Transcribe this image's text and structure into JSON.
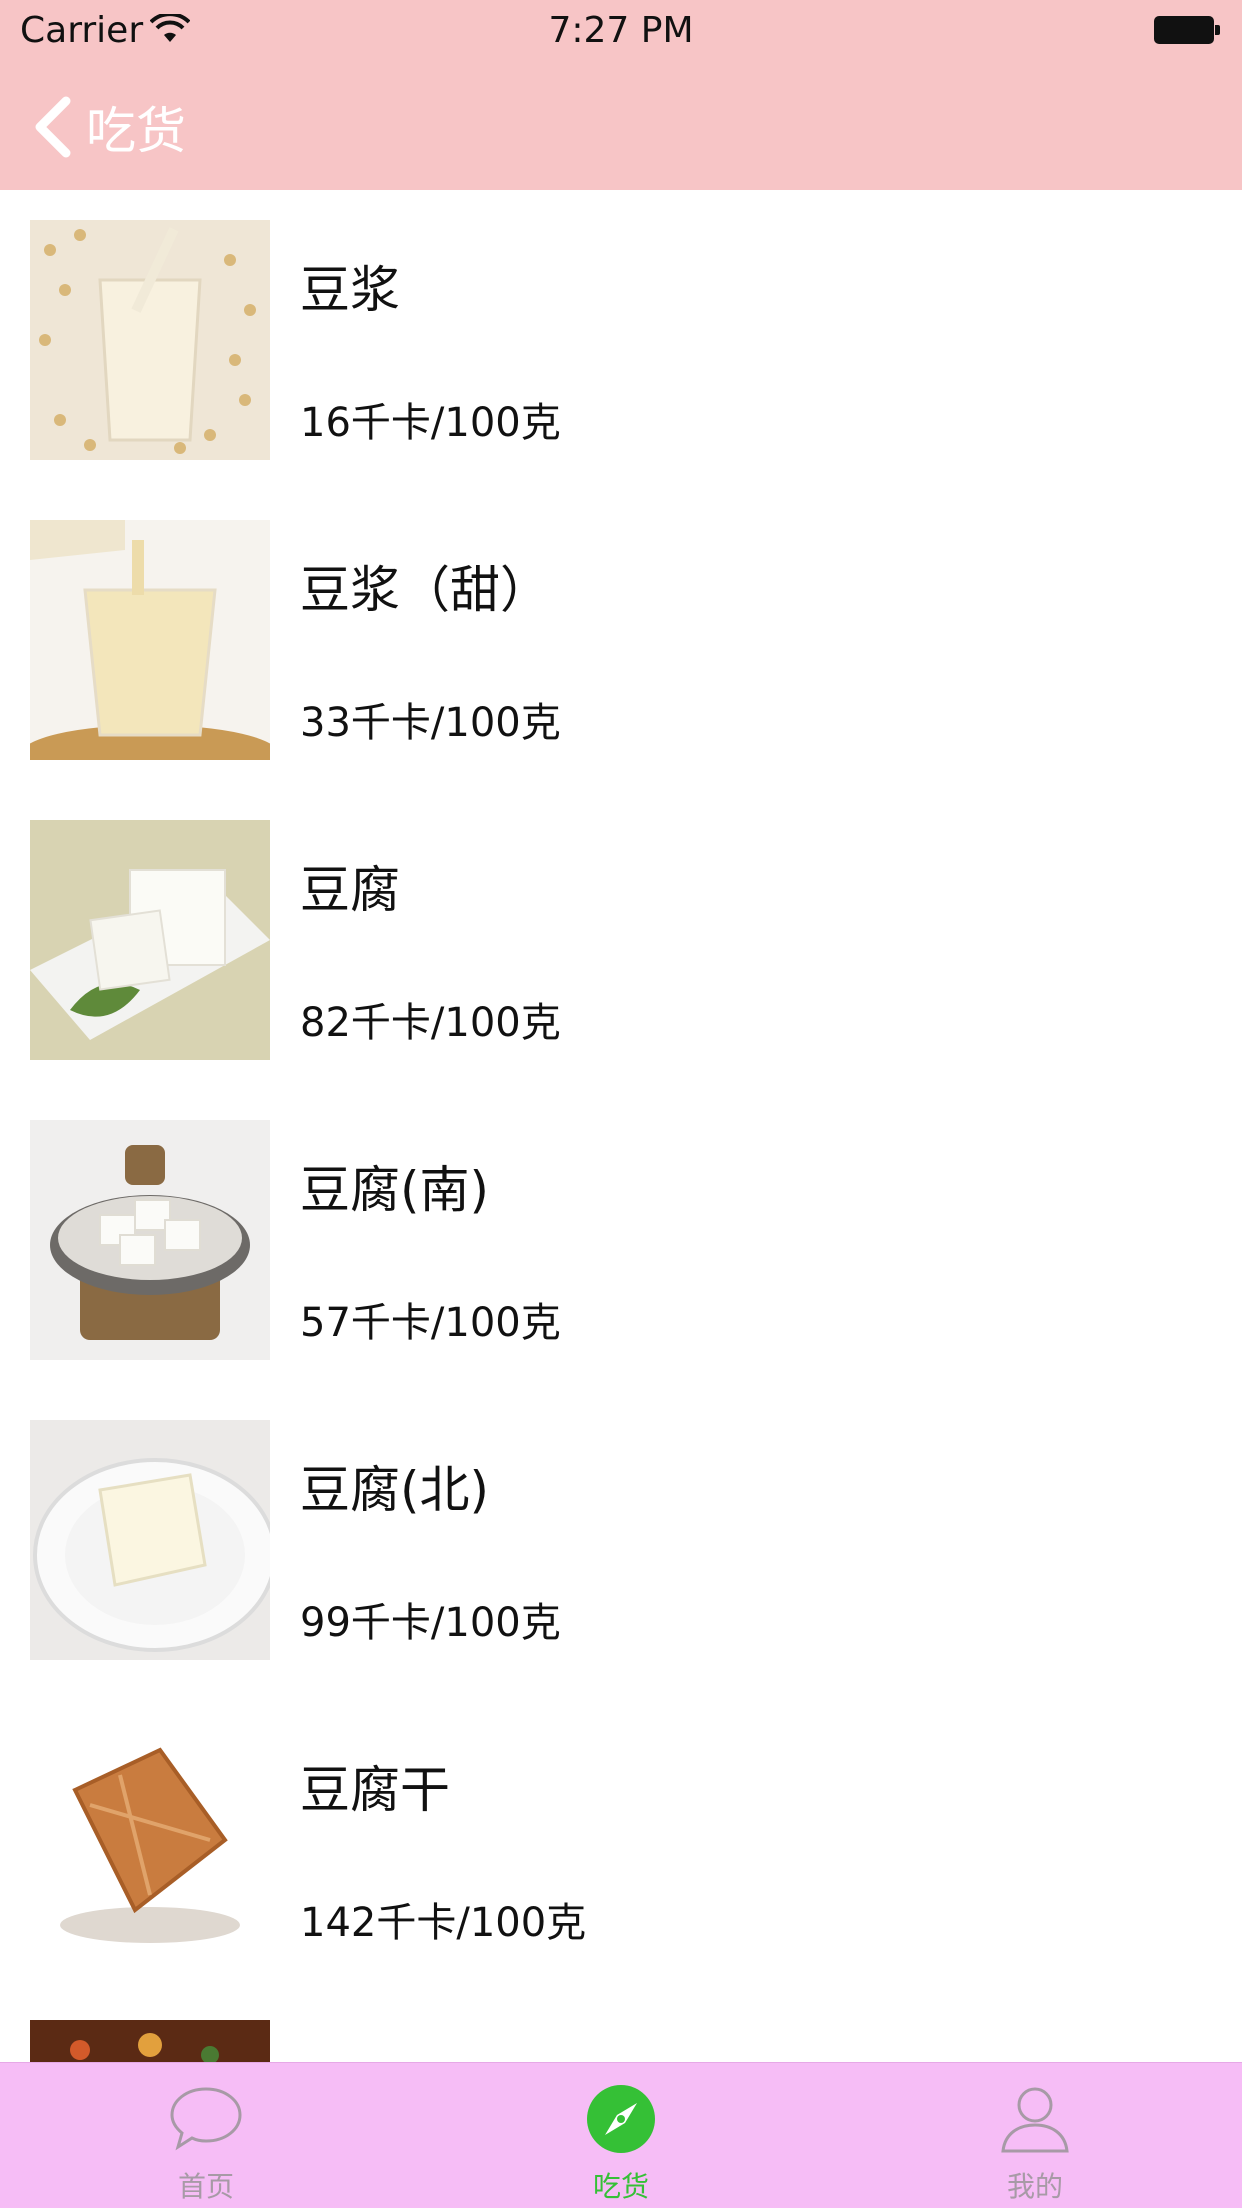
{
  "status_bar": {
    "carrier": "Carrier",
    "time": "7:27 PM"
  },
  "nav": {
    "back_label": "吃货"
  },
  "foods": [
    {
      "name": "豆浆",
      "calories": "16千卡/100克",
      "image": "soy-milk-glass-with-beans"
    },
    {
      "name": "豆浆（甜）",
      "calories": "33千卡/100克",
      "image": "soy-milk-pouring"
    },
    {
      "name": "豆腐",
      "calories": "82千卡/100克",
      "image": "tofu-on-plate"
    },
    {
      "name": "豆腐(南)",
      "calories": "57千卡/100克",
      "image": "tofu-in-bowl"
    },
    {
      "name": "豆腐(北)",
      "calories": "99千卡/100克",
      "image": "tofu-block-on-plate"
    },
    {
      "name": "豆腐干",
      "calories": "142千卡/100克",
      "image": "dried-tofu"
    },
    {
      "name": "",
      "calories": "",
      "image": "stew-partial"
    }
  ],
  "tabbar": {
    "items": [
      {
        "label": "首页",
        "icon": "chat-bubble-icon",
        "active": false
      },
      {
        "label": "吃货",
        "icon": "compass-icon",
        "active": true
      },
      {
        "label": "我的",
        "icon": "person-icon",
        "active": false
      }
    ],
    "active_color": "#35c036",
    "inactive_color": "#a79aa6"
  },
  "colors": {
    "header_bg": "#f7c5c6",
    "tabbar_bg": "#f6bdf6"
  }
}
